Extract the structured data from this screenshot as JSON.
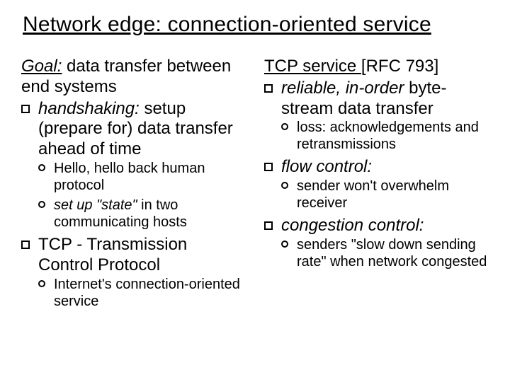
{
  "title": "Network edge: connection-oriented service",
  "left": {
    "goal_label": "Goal:",
    "goal_rest": " data transfer between end systems",
    "bullets": [
      {
        "text_pre": "handshaking:",
        "text_post": " setup (prepare for) data transfer ahead of time",
        "sub": [
          {
            "text": "Hello, hello back human protocol"
          },
          {
            "text_pre": "set up \"state\"",
            "text_post": " in two communicating hosts"
          }
        ]
      },
      {
        "text": "TCP - Transmission Control Protocol",
        "sub": [
          {
            "text": "Internet's connection-oriented service"
          }
        ]
      }
    ]
  },
  "right": {
    "tcp_label": "TCP service ",
    "tcp_rfc": "[RFC 793]",
    "bullets": [
      {
        "text_pre": "reliable, in-order",
        "text_post": " byte-stream data transfer",
        "sub": [
          {
            "text": "loss: acknowledgements and retransmissions"
          }
        ]
      },
      {
        "text": "flow control:",
        "ital": true,
        "sub": [
          {
            "text": "sender won't overwhelm receiver"
          }
        ]
      },
      {
        "text": "congestion control:",
        "ital": true,
        "sub": [
          {
            "text": "senders \"slow down sending rate\" when network congested"
          }
        ]
      }
    ]
  }
}
